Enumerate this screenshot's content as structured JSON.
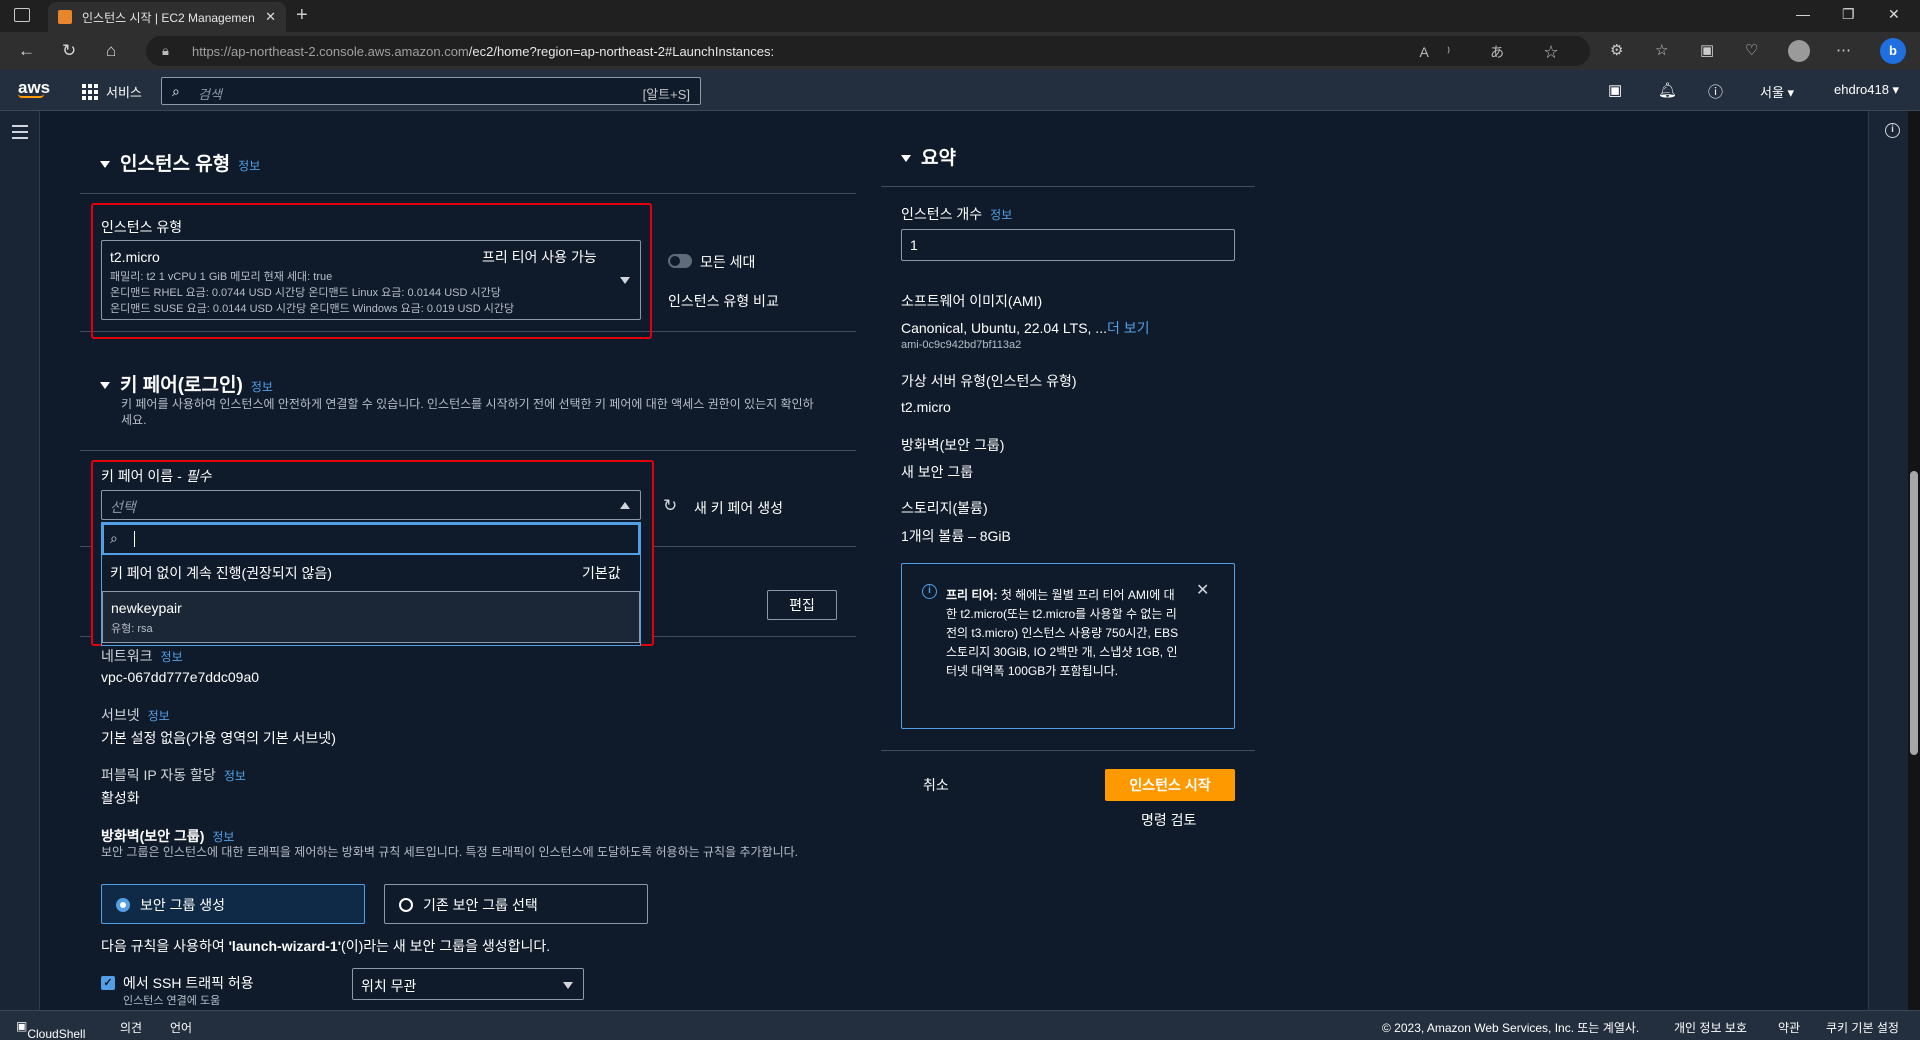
{
  "browser": {
    "tab_title": "인스턴스 시작 | EC2 Managemen",
    "url_host": "https://ap-northeast-2.console.aws.amazon.com",
    "url_path": "/ec2/home?region=ap-northeast-2#LaunchInstances:"
  },
  "aws_nav": {
    "logo": "aws",
    "services": "서비스",
    "search_placeholder": "검색",
    "search_shortcut": "[알트+S]",
    "region": "서울 ▾",
    "account": "ehdro418 ▾"
  },
  "instance_type_section": {
    "title": "인스턴스 유형",
    "info": "정보",
    "field_label": "인스턴스 유형",
    "selected_type": "t2.micro",
    "free_tier": "프리 티어 사용 가능",
    "line1": "패밀리: t2    1 vCPU    1 GiB 메모리    현재 세대: true",
    "line2": "온디맨드 RHEL 요금: 0.0744 USD 시간당    온디맨드 Linux 요금: 0.0144 USD 시간당",
    "line3": "온디맨드 SUSE 요금: 0.0144 USD 시간당    온디맨드 Windows 요금: 0.019 USD 시간당",
    "all_generations": "모든 세대",
    "compare_link": "인스턴스 유형 비교"
  },
  "key_pair_section": {
    "title": "키 페어(로그인)",
    "info": "정보",
    "description": "키 페어를 사용하여 인스턴스에 안전하게 연결할 수 있습니다. 인스턴스를 시작하기 전에 선택한 키 페어에 대한 액세스 권한이 있는지 확인하세요.",
    "field_label": "키 페어 이름 - ",
    "required": "필수",
    "select_placeholder": "선택",
    "create_link": "새 키 페어 생성",
    "options": [
      {
        "label": "키 페어 없이 계속 진행(권장되지 않음)",
        "tag": "기본값"
      },
      {
        "label": "newkeypair",
        "sub": "유형: rsa"
      }
    ]
  },
  "network_section": {
    "edit_button": "편집",
    "network_label": "네트워크",
    "network_value": "vpc-067dd777e7ddc09a0",
    "subnet_label": "서브넷",
    "subnet_value": "기본 설정 없음(가용 영역의 기본 서브넷)",
    "public_ip_label": "퍼블릭 IP 자동 할당",
    "public_ip_value": "활성화",
    "info": "정보",
    "firewall_label": "방화벽(보안 그룹)",
    "firewall_desc": "보안 그룹은 인스턴스에 대한 트래픽을 제어하는 방화벽 규칙 세트입니다. 특정 트래픽이 인스턴스에 도달하도록 허용하는 규칙을 추가합니다.",
    "create_sg": "보안 그룹 생성",
    "select_sg": "기존 보안 그룹 선택",
    "rule_note_pre": "다음 규칙을 사용하여 ",
    "rule_note_name": "'launch-wizard-1'",
    "rule_note_post": "(이)라는 새 보안 그룹을 생성합니다.",
    "ssh_label": "에서 SSH 트래픽 허용",
    "ssh_sub": "인스턴스 연결에 도움",
    "ssh_source": "위치 무관"
  },
  "summary": {
    "title": "요약",
    "count_label": "인스턴스 개수",
    "info": "정보",
    "count_value": "1",
    "ami_label": "소프트웨어 이미지(AMI)",
    "ami_value": "Canonical, Ubuntu, 22.04 LTS, ...",
    "ami_more": "더 보기",
    "ami_id": "ami-0c9c942bd7bf113a2",
    "vtype_label": "가상 서버 유형(인스턴스 유형)",
    "vtype_value": "t2.micro",
    "fw_label": "방화벽(보안 그룹)",
    "fw_value": "새 보안 그룹",
    "storage_label": "스토리지(볼륨)",
    "storage_value": "1개의 볼륨 – 8GiB",
    "free_tier_bold": "프리 티어:",
    "free_tier_text": " 첫 해에는 월별 프리 티어 AMI에 대한 t2.micro(또는 t2.micro를 사용할 수 없는 리전의 t3.micro) 인스턴스 사용량 750시간, EBS 스토리지 30GiB, IO 2백만 개, 스냅샷 1GB, 인터넷 대역폭 100GB가 포함됩니다.",
    "cancel": "취소",
    "launch": "인스턴스 시작",
    "review": "명령 검토"
  },
  "footer": {
    "cloudshell": "CloudShell",
    "feedback": "의견",
    "language": "언어",
    "copyright": "© 2023, Amazon Web Services, Inc. 또는 계열사.",
    "privacy": "개인 정보 보호",
    "terms": "약관",
    "cookies": "쿠키 기본 설정"
  },
  "colors": {
    "accent": "#539fe5",
    "highlight": "#e3000b",
    "launch": "#ff9900"
  }
}
